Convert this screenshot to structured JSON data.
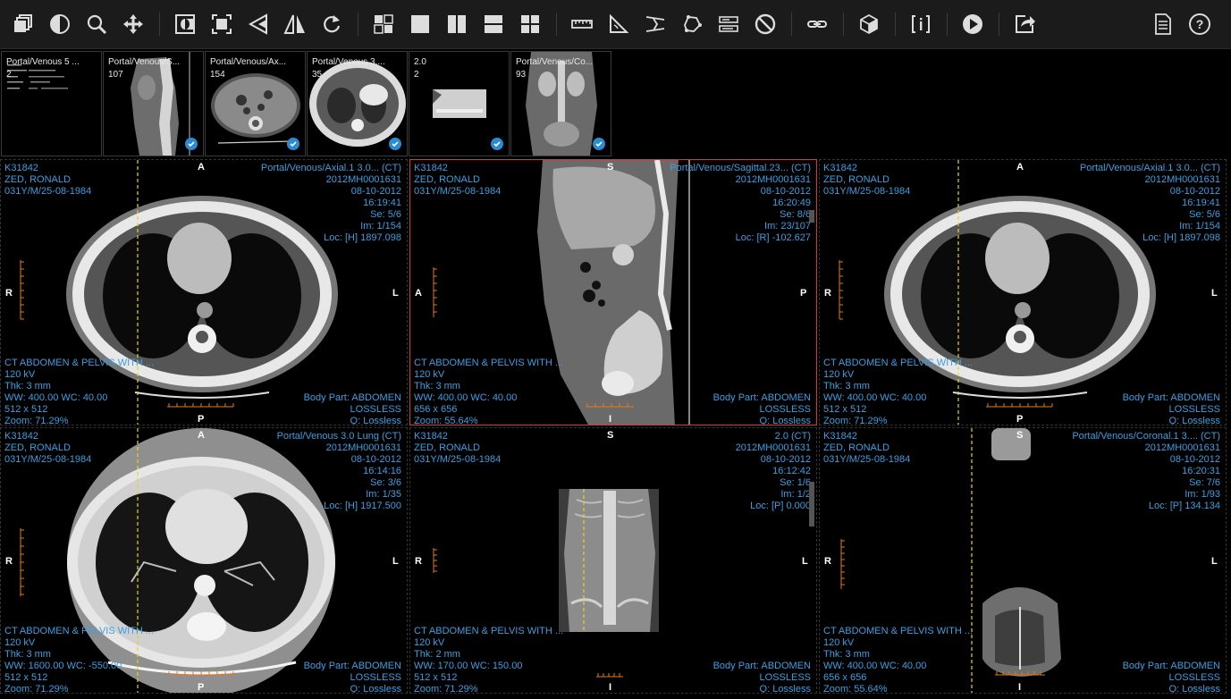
{
  "toolbar": {
    "tools": [
      {
        "name": "stack-tool-icon"
      },
      {
        "name": "contrast-icon"
      },
      {
        "name": "zoom-icon"
      },
      {
        "name": "pan-icon"
      },
      {
        "name": "invert-icon"
      },
      {
        "name": "fit-icon"
      },
      {
        "name": "flip-horizontal-icon"
      },
      {
        "name": "flip-vertical-icon"
      },
      {
        "name": "rotate-icon"
      },
      {
        "name": "layout-grid-icon"
      },
      {
        "name": "layout-1x1-icon"
      },
      {
        "name": "layout-1x2-icon"
      },
      {
        "name": "layout-2x1-icon"
      },
      {
        "name": "layout-2x2-icon"
      },
      {
        "name": "ruler-icon"
      },
      {
        "name": "angle-icon"
      },
      {
        "name": "cobb-angle-icon"
      },
      {
        "name": "freehand-roi-icon"
      },
      {
        "name": "annotation-icon"
      },
      {
        "name": "clear-icon"
      },
      {
        "name": "link-icon"
      },
      {
        "name": "3d-cube-icon"
      },
      {
        "name": "info-icon"
      },
      {
        "name": "play-icon"
      },
      {
        "name": "share-icon"
      },
      {
        "name": "report-icon"
      },
      {
        "name": "help-icon"
      }
    ]
  },
  "thumbnails": [
    {
      "title": "Portal/Venous 5 ...",
      "count": "2",
      "checked": false
    },
    {
      "title": "Portal/Venous/S...",
      "count": "107",
      "checked": true
    },
    {
      "title": "Portal/Venous/Ax...",
      "count": "154",
      "checked": true
    },
    {
      "title": "Portal/Venous 3....",
      "count": "35",
      "checked": true
    },
    {
      "title": "2.0",
      "count": "2",
      "checked": true
    },
    {
      "title": "Portal/Venous/Co...",
      "count": "93",
      "checked": true
    }
  ],
  "viewports": [
    {
      "tl": [
        "K31842",
        "ZED, RONALD",
        "031Y/M/25-08-1984"
      ],
      "tr": [
        "Portal/Venous/Axial.1 3.0... (CT)",
        "2012MH0001631",
        "08-10-2012",
        "16:19:41",
        "Se: 5/6",
        "Im: 1/154",
        "Loc: [H] 1897.098"
      ],
      "bl": [
        "CT ABDOMEN & PELVIS WITH ...",
        "120 kV",
        "Thk: 3 mm",
        "WW: 400.00 WC: 40.00",
        "512 x 512",
        "Zoom: 71.29%"
      ],
      "br": [
        "Body Part: ABDOMEN",
        "LOSSLESS",
        "Q: Lossless"
      ],
      "top": "A",
      "bottom": "P",
      "left": "R",
      "right": "L"
    },
    {
      "tl": [
        "K31842",
        "ZED, RONALD",
        "031Y/M/25-08-1984"
      ],
      "tr": [
        "Portal/Venous/Sagittal.23... (CT)",
        "2012MH0001631",
        "08-10-2012",
        "16:20:49",
        "Se: 8/6",
        "Im: 23/107",
        "Loc: [R] -102.627"
      ],
      "bl": [
        "CT ABDOMEN & PELVIS WITH ...",
        "120 kV",
        "Thk: 3 mm",
        "WW: 400.00 WC: 40.00",
        "656 x 656",
        "Zoom: 55.64%"
      ],
      "br": [
        "Body Part: ABDOMEN",
        "LOSSLESS",
        "Q: Lossless"
      ],
      "top": "S",
      "bottom": "I",
      "left": "A",
      "right": "P"
    },
    {
      "tl": [
        "K31842",
        "ZED, RONALD",
        "031Y/M/25-08-1984"
      ],
      "tr": [
        "Portal/Venous/Axial.1 3.0... (CT)",
        "2012MH0001631",
        "08-10-2012",
        "16:19:41",
        "Se: 5/6",
        "Im: 1/154",
        "Loc: [H] 1897.098"
      ],
      "bl": [
        "CT ABDOMEN & PELVIS WITH ...",
        "120 kV",
        "Thk: 3 mm",
        "WW: 400.00 WC: 40.00",
        "512 x 512",
        "Zoom: 71.29%"
      ],
      "br": [
        "Body Part: ABDOMEN",
        "LOSSLESS",
        "Q: Lossless"
      ],
      "top": "A",
      "bottom": "P",
      "left": "R",
      "right": "L"
    },
    {
      "tl": [
        "K31842",
        "ZED, RONALD",
        "031Y/M/25-08-1984"
      ],
      "tr": [
        "Portal/Venous 3.0  Lung (CT)",
        "2012MH0001631",
        "08-10-2012",
        "16:14:16",
        "Se: 3/6",
        "Im: 1/35",
        "Loc: [H] 1917.500"
      ],
      "bl": [
        "CT ABDOMEN & PELVIS WITH ...",
        "120 kV",
        "Thk: 3 mm",
        "WW: 1600.00 WC: -550.00",
        "512 x 512",
        "Zoom: 71.29%"
      ],
      "br": [
        "Body Part: ABDOMEN",
        "LOSSLESS",
        "Q: Lossless"
      ],
      "top": "A",
      "bottom": "P",
      "left": "R",
      "right": "L"
    },
    {
      "tl": [
        "K31842",
        "ZED, RONALD",
        "031Y/M/25-08-1984"
      ],
      "tr": [
        "2.0 (CT)",
        "2012MH0001631",
        "08-10-2012",
        "16:12:42",
        "Se: 1/6",
        "Im: 1/2",
        "Loc: [P] 0.000"
      ],
      "bl": [
        "CT ABDOMEN & PELVIS WITH ...",
        "120 kV",
        "Thk: 2 mm",
        "WW: 170.00 WC: 150.00",
        "512 x 512",
        "Zoom: 71.29%"
      ],
      "br": [
        "Body Part: ABDOMEN",
        "LOSSLESS",
        "Q: Lossless"
      ],
      "top": "S",
      "bottom": "I",
      "left": "R",
      "right": "L"
    },
    {
      "tl": [
        "K31842",
        "ZED, RONALD",
        "031Y/M/25-08-1984"
      ],
      "tr": [
        "Portal/Venous/Coronal.1 3.... (CT)",
        "2012MH0001631",
        "08-10-2012",
        "16:20:31",
        "Se: 7/6",
        "Im: 1/93",
        "Loc: [P] 134.134"
      ],
      "bl": [
        "CT ABDOMEN & PELVIS WITH ...",
        "120 kV",
        "Thk: 3 mm",
        "WW: 400.00 WC: 40.00",
        "656 x 656",
        "Zoom: 55.64%"
      ],
      "br": [
        "Body Part: ABDOMEN",
        "LOSSLESS",
        "Q: Lossless"
      ],
      "top": "S",
      "bottom": "I",
      "left": "R",
      "right": "L"
    }
  ],
  "colors": {
    "overlay_text": "#3d9fe0",
    "active_border": "#d23b3b",
    "reference_line": "#e8d21e",
    "ruler": "#e07a1e",
    "check": "#2a8bd0"
  }
}
